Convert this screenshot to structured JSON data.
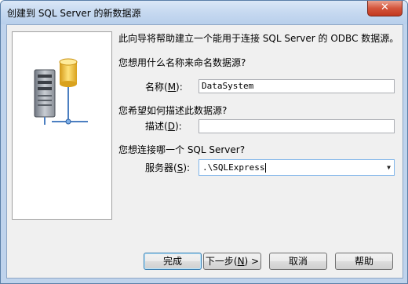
{
  "window": {
    "title": "创建到 SQL Server 的新数据源",
    "close_glyph": "✕"
  },
  "intro": "此向导将帮助建立一个能用于连接 SQL Server 的 ODBC 数据源。",
  "name_question": "您想用什么名称来命名数据源?",
  "name_label_pre": "名称(",
  "name_label_key": "M",
  "name_label_post": "):",
  "name_value": "DataSystem",
  "desc_question": "您希望如何描述此数据源?",
  "desc_label_pre": "描述(",
  "desc_label_key": "D",
  "desc_label_post": "):",
  "desc_value": "",
  "server_question": "您想连接哪一个 SQL Server?",
  "server_label_pre": "服务器(",
  "server_label_key": "S",
  "server_label_post": "):",
  "server_value": ".\\SQLExpress",
  "buttons": {
    "finish": "完成",
    "next_pre": "下一步(",
    "next_key": "N",
    "next_post": ") >",
    "cancel": "取消",
    "help": "帮助"
  }
}
